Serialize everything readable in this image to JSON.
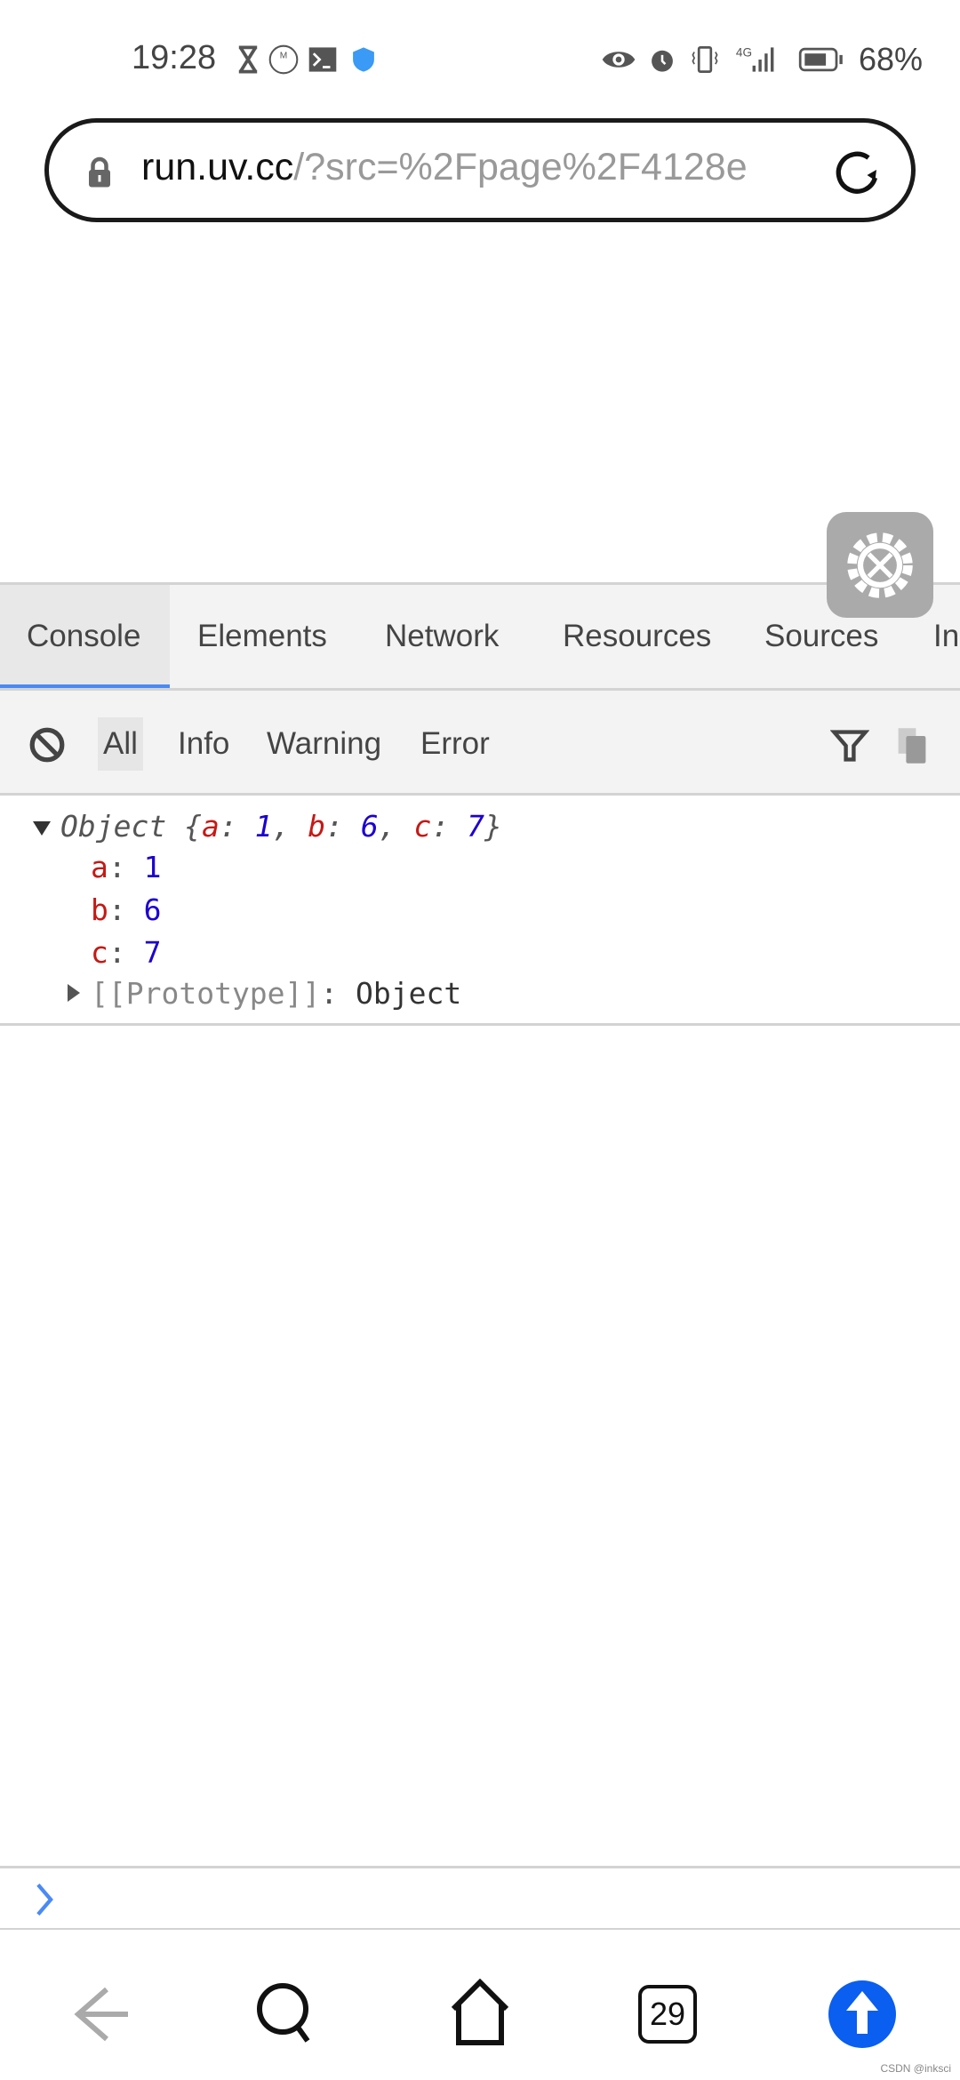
{
  "status_bar": {
    "time": "19:28",
    "battery": "68%",
    "icons": [
      "hourglass-icon",
      "metro-icon",
      "terminal-icon",
      "shield-icon",
      "eye-icon",
      "alarm-icon",
      "vibrate-icon",
      "4g-signal-icon",
      "battery-icon"
    ]
  },
  "address_bar": {
    "url_host": "run.uv.cc",
    "url_rest": "/?src=%2Fpage%2F4128e"
  },
  "devtools": {
    "tabs": [
      {
        "label": "Console",
        "active": true
      },
      {
        "label": "Elements"
      },
      {
        "label": "Network"
      },
      {
        "label": "Resources"
      },
      {
        "label": "Sources"
      },
      {
        "label": "In"
      }
    ],
    "filters": [
      {
        "label": "All",
        "active": true
      },
      {
        "label": "Info"
      },
      {
        "label": "Warning"
      },
      {
        "label": "Error"
      }
    ],
    "accent": "#4a8af4"
  },
  "console": {
    "summary": {
      "type": "Object",
      "open": "{",
      "close": "}",
      "entries": [
        {
          "key": "a",
          "value": "1"
        },
        {
          "key": "b",
          "value": "6"
        },
        {
          "key": "c",
          "value": "7"
        }
      ]
    },
    "props": [
      {
        "key": "a",
        "value": "1"
      },
      {
        "key": "b",
        "value": "6"
      },
      {
        "key": "c",
        "value": "7"
      }
    ],
    "prototype": {
      "key": "[[Prototype]]",
      "value": "Object"
    }
  },
  "nav": {
    "tab_count": "29",
    "update_color": "#0a5ef0"
  },
  "watermark": "CSDN @inksci"
}
